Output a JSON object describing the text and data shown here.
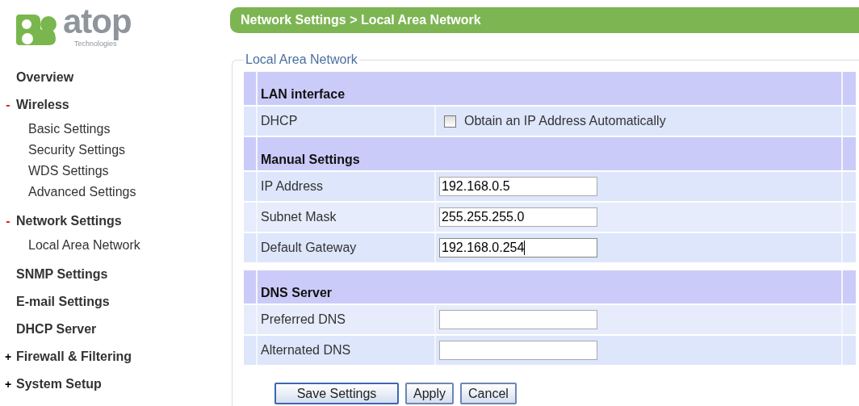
{
  "logo": {
    "name": "atop",
    "tagline": "Technologies"
  },
  "sidebar": {
    "items": [
      {
        "label": "Overview"
      },
      {
        "label": "Wireless",
        "marker": "-",
        "expanded": true,
        "children": [
          {
            "label": "Basic Settings"
          },
          {
            "label": "Security Settings"
          },
          {
            "label": "WDS Settings"
          },
          {
            "label": "Advanced Settings"
          }
        ]
      },
      {
        "label": "Network Settings",
        "marker": "-",
        "expanded": true,
        "children": [
          {
            "label": "Local Area Network"
          }
        ]
      },
      {
        "label": "SNMP Settings"
      },
      {
        "label": "E-mail Settings"
      },
      {
        "label": "DHCP Server"
      },
      {
        "label": "Firewall & Filtering",
        "marker": "+",
        "expanded": false
      },
      {
        "label": "System Setup",
        "marker": "+",
        "expanded": false
      }
    ]
  },
  "breadcrumb": "Network Settings > Local Area Network",
  "form": {
    "legend": "Local Area Network",
    "rows": [
      {
        "kind": "section",
        "label": "LAN interface"
      },
      {
        "kind": "checkbox",
        "label": "DHCP",
        "option": "Obtain an IP Address Automatically",
        "checked": false
      },
      {
        "kind": "section",
        "label": "Manual Settings"
      },
      {
        "kind": "input",
        "label": "IP Address",
        "value": "192.168.0.5",
        "focused": false
      },
      {
        "kind": "input",
        "label": "Subnet Mask",
        "value": "255.255.255.0",
        "focused": false
      },
      {
        "kind": "input",
        "label": "Default Gateway",
        "value": "192.168.0.254",
        "focused": true
      },
      {
        "kind": "gap"
      },
      {
        "kind": "section",
        "label": "DNS Server"
      },
      {
        "kind": "input",
        "label": "Preferred DNS",
        "focused": false
      },
      {
        "kind": "input",
        "label": "Alternated DNS",
        "focused": false
      }
    ]
  },
  "buttons": [
    {
      "label": "Save Settings",
      "primary": true
    },
    {
      "label": "Apply",
      "primary": false
    },
    {
      "label": "Cancel",
      "primary": false
    }
  ]
}
